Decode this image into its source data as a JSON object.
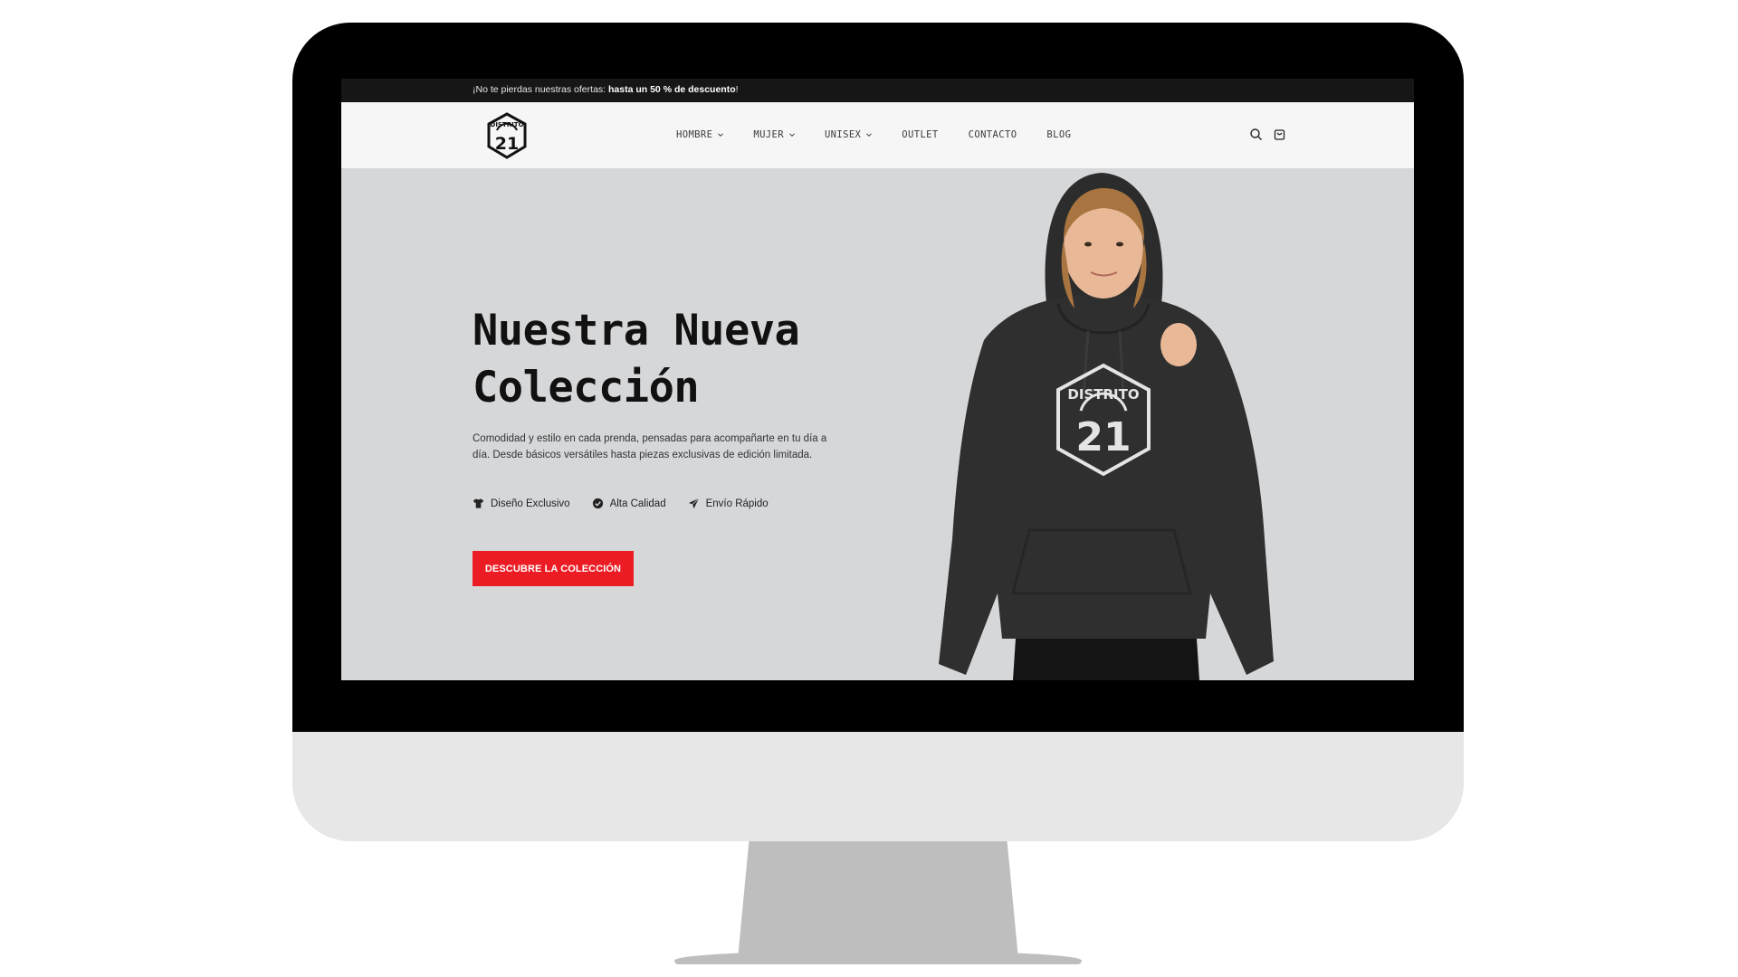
{
  "promo": {
    "text": "¡No te pierdas nuestras ofertas: ",
    "highlight": "hasta un 50 % de descuento",
    "suffix": "!"
  },
  "logo": {
    "top_text": "DISTRITO",
    "number": "21"
  },
  "nav": {
    "items": [
      {
        "label": "HOMBRE",
        "has_dropdown": true
      },
      {
        "label": "MUJER",
        "has_dropdown": true
      },
      {
        "label": "UNISEX",
        "has_dropdown": true
      },
      {
        "label": "OUTLET",
        "has_dropdown": false
      },
      {
        "label": "CONTACTO",
        "has_dropdown": false
      },
      {
        "label": "BLOG",
        "has_dropdown": false
      }
    ]
  },
  "header_icons": [
    "search-icon",
    "cart-icon"
  ],
  "hero": {
    "title_line1": "Nuestra Nueva",
    "title_line2": "Colección",
    "description": "Comodidad y estilo en cada prenda, pensadas para acompañarte en tu día a día. Desde básicos versátiles hasta piezas exclusivas de edición limitada.",
    "features": [
      {
        "icon": "tshirt-icon",
        "label": "Diseño Exclusivo"
      },
      {
        "icon": "check-circle-icon",
        "label": "Alta Calidad"
      },
      {
        "icon": "paper-plane-icon",
        "label": "Envío Rápido"
      }
    ],
    "cta_label": "DESCUBRE LA COLECCIÓN",
    "hoodie_print": {
      "top": "DISTRITO",
      "number": "21"
    }
  },
  "colors": {
    "promo_bg": "#161616",
    "header_bg": "#f5f6f5",
    "hero_bg": "#d6d7d9",
    "cta_bg": "#ec1c24",
    "hoodie": "#2f2f2f",
    "monitor_frame": "#000000",
    "monitor_chin": "#e7e7e7",
    "stand": "#bebebe"
  }
}
